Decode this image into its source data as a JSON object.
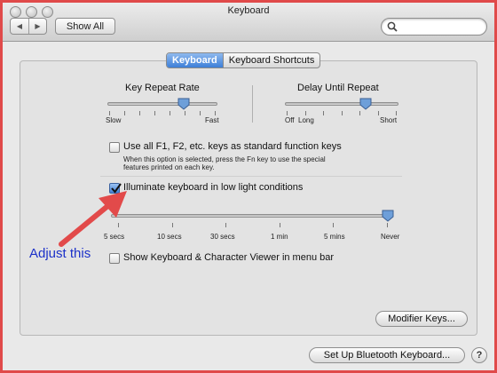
{
  "window": {
    "title": "Keyboard"
  },
  "toolbar": {
    "back": "◀",
    "forward": "▶",
    "show_all": "Show All",
    "search_icon": "search-icon"
  },
  "tabs": [
    {
      "label": "Keyboard",
      "active": true
    },
    {
      "label": "Keyboard Shortcuts",
      "active": false
    }
  ],
  "key_repeat": {
    "title": "Key Repeat Rate",
    "min_label": "Slow",
    "max_label": "Fast",
    "position": 0.7
  },
  "delay_repeat": {
    "title": "Delay Until Repeat",
    "min_label": "Off",
    "mid_label": "Long",
    "max_label": "Short",
    "position": 0.72
  },
  "fn_keys": {
    "label": "Use all F1, F2, etc. keys as standard function keys",
    "checked": false,
    "help_line1": "When this option is selected, press the Fn key to use the special",
    "help_line2": "features printed on each key."
  },
  "illuminate": {
    "label": "Illuminate keyboard in low light conditions",
    "checked": true,
    "position": 1.0,
    "ticks": [
      "5 secs",
      "10 secs",
      "30 secs",
      "1 min",
      "5 mins",
      "Never"
    ]
  },
  "viewer": {
    "label": "Show Keyboard & Character Viewer in menu bar",
    "checked": false
  },
  "buttons": {
    "modifier": "Modifier Keys...",
    "bluetooth": "Set Up Bluetooth Keyboard...",
    "help": "?"
  },
  "annotation": {
    "text": "Adjust this",
    "color": "#1c31c9",
    "arrow_color": "#e24a4a"
  },
  "colors": {
    "frame": "#e04a4a",
    "accent": "#3d7fd8"
  }
}
